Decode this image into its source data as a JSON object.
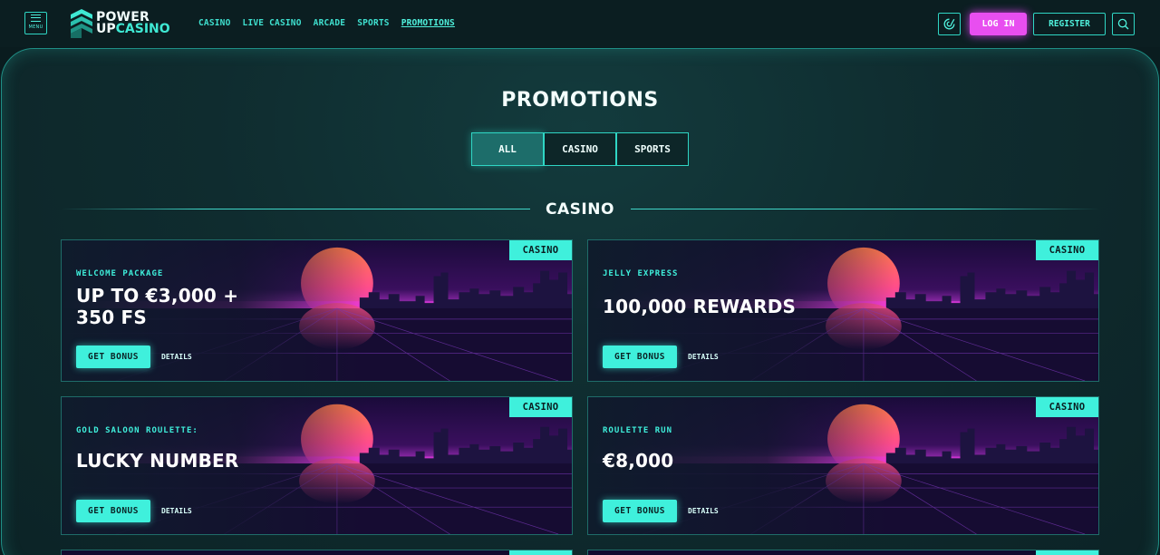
{
  "header": {
    "menu_label": "MENU",
    "logo": {
      "line1": "POWER",
      "line2_a": "UP",
      "line2_b": "CASINO"
    },
    "nav": [
      {
        "label": "CASINO",
        "active": false
      },
      {
        "label": "LIVE CASINO",
        "active": false
      },
      {
        "label": "ARCADE",
        "active": false
      },
      {
        "label": "SPORTS",
        "active": false
      },
      {
        "label": "PROMOTIONS",
        "active": true
      }
    ],
    "login_label": "LOG IN",
    "register_label": "REGISTER",
    "icons": {
      "menu": "hamburger-icon",
      "support": "chat-support-icon",
      "search": "search-icon"
    }
  },
  "page": {
    "title": "PROMOTIONS",
    "filters": [
      {
        "label": "ALL",
        "active": true
      },
      {
        "label": "CASINO",
        "active": false
      },
      {
        "label": "SPORTS",
        "active": false
      }
    ],
    "section_title": "CASINO"
  },
  "cards": [
    {
      "tag": "CASINO",
      "subtitle": "WELCOME PACKAGE",
      "headline_l1": "UP TO €3,000 +",
      "headline_l2": "350 FS",
      "cta": "GET BONUS",
      "details": "DETAILS"
    },
    {
      "tag": "CASINO",
      "subtitle": "JELLY EXPRESS",
      "headline_l1": "100,000 REWARDS",
      "headline_l2": "",
      "cta": "GET BONUS",
      "details": "DETAILS"
    },
    {
      "tag": "CASINO",
      "subtitle": "GOLD SALOON ROULETTE:",
      "headline_l1": "LUCKY NUMBER",
      "headline_l2": "",
      "cta": "GET BONUS",
      "details": "DETAILS"
    },
    {
      "tag": "CASINO",
      "subtitle": "ROULETTE RUN",
      "headline_l1": "€8,000",
      "headline_l2": "",
      "cta": "GET BONUS",
      "details": "DETAILS"
    }
  ],
  "colors": {
    "accent": "#3ff0dc",
    "login": "#e84ef0",
    "background": "#0a1c1f"
  }
}
